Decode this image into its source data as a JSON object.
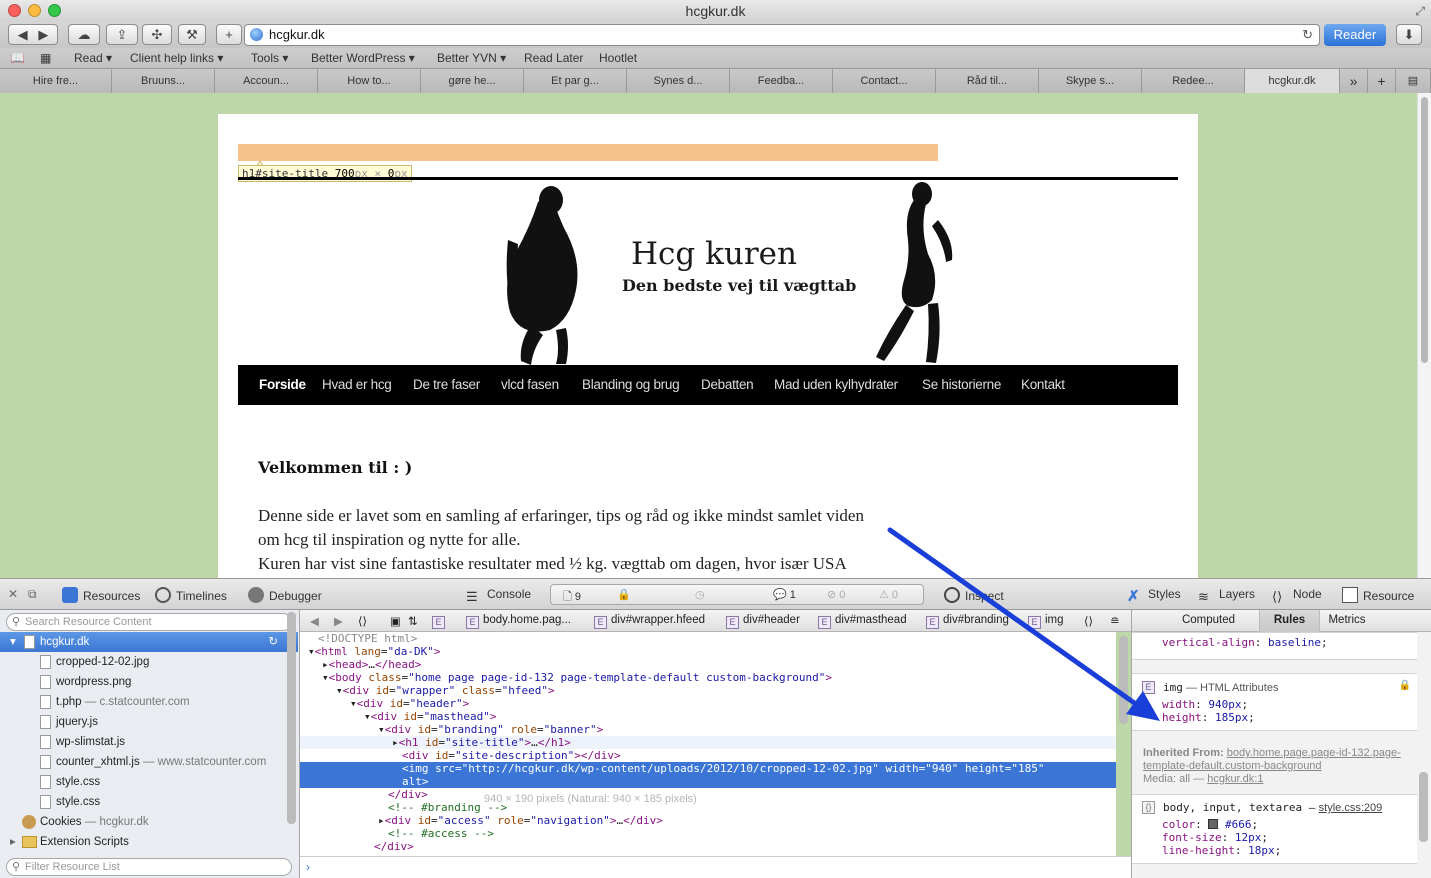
{
  "window": {
    "title": "hcgkur.dk"
  },
  "toolbar": {
    "url": "hcgkur.dk",
    "reader_label": "Reader",
    "plus_label": "+"
  },
  "bookmarks": [
    "Read ▾",
    "Client help links ▾",
    "Tools ▾",
    "Better WordPress ▾",
    "Better YVN ▾",
    "Read Later",
    "Hootlet"
  ],
  "tabs": [
    "Hire fre...",
    "Bruuns...",
    "Accoun...",
    "How to...",
    "gøre he...",
    "Et par g...",
    "Synes d...",
    "Feedba...",
    "Contact...",
    "Råd til...",
    "Skype s...",
    "Redee...",
    "hcgkur.dk"
  ],
  "page": {
    "h1_tip": {
      "selector": "h1#site-title",
      "width": "700",
      "height": "0",
      "unit": "px",
      "times": "×"
    },
    "site_name": "Hcg kuren",
    "site_description": "Den bedste vej til vægttab",
    "nav": [
      "Forside",
      "Hvad er hcg",
      "De tre faser",
      "vlcd fasen",
      "Blanding og brug",
      "Debatten",
      "Mad uden kylhydrater",
      "Se historierne",
      "Kontakt"
    ],
    "welcome": "Velkommen til : )",
    "paragraph_lines": [
      "Denne side er lavet som en samling af erfaringer, tips og råd og ikke mindst samlet viden",
      "om hcg til inspiration og nytte for alle.",
      "Kuren har vist sine fantastiske resultater med ½ kg. vægttab om dagen, hvor især USA"
    ]
  },
  "inspector": {
    "tools": {
      "resources": "Resources",
      "timelines": "Timelines",
      "debugger": "Debugger",
      "console": "Console",
      "inspect": "Inspect",
      "styles": "Styles",
      "layers": "Layers",
      "node": "Node",
      "resource": "Resource"
    },
    "counters": {
      "resources": "9",
      "errors": "0",
      "logs": "1",
      "warnings": "0"
    },
    "search_placeholder": "Search Resource Content",
    "filter_placeholder": "Filter Resource List",
    "resources": [
      {
        "name": "hcgkur.dk",
        "domain": ""
      },
      {
        "name": "cropped-12-02.jpg",
        "domain": ""
      },
      {
        "name": "wordpress.png",
        "domain": ""
      },
      {
        "name": "t.php",
        "domain": "— c.statcounter.com"
      },
      {
        "name": "jquery.js",
        "domain": ""
      },
      {
        "name": "wp-slimstat.js",
        "domain": ""
      },
      {
        "name": "counter_xhtml.js",
        "domain": "— www.statcounter.com"
      },
      {
        "name": "style.css",
        "domain": ""
      },
      {
        "name": "style.css",
        "domain": ""
      },
      {
        "name": "Cookies",
        "domain": "— hcgkur.dk"
      },
      {
        "name": "Extension Scripts",
        "domain": ""
      }
    ],
    "breadcrumbs": [
      "body.home.pag...",
      "div#wrapper.hfeed",
      "div#header",
      "div#masthead",
      "div#branding",
      "img"
    ],
    "img_tooltip": "940 × 190 pixels (Natural: 940 × 185 pixels)",
    "styles_tabs": [
      "Computed",
      "Rules",
      "Metrics"
    ],
    "rules": {
      "top_prop": "vertical-align",
      "top_val": "baseline",
      "img_selector": "img",
      "img_source": "— HTML Attributes",
      "img_width_prop": "width",
      "img_width_val": "940px",
      "img_height_prop": "height",
      "img_height_val": "185px",
      "inherited_label": "Inherited From:",
      "inherited_from": "body.home.page.page-id-132.page-template-default.custom-background",
      "media_label": "Media: all —",
      "media_source": "hcgkur.dk:1",
      "body_selector": "body, input, textarea —",
      "body_source": "style.css:209",
      "color_prop": "color",
      "color_val": "#666",
      "font_size_prop": "font-size",
      "font_size_val": "12px",
      "line_height_prop": "line-height",
      "line_height_val": "18px"
    }
  },
  "colors": {
    "page_bg": "#bdd7a8",
    "highlight": "#f6c28d",
    "selection": "#3b76d6",
    "arrow": "#1a3fd8"
  }
}
